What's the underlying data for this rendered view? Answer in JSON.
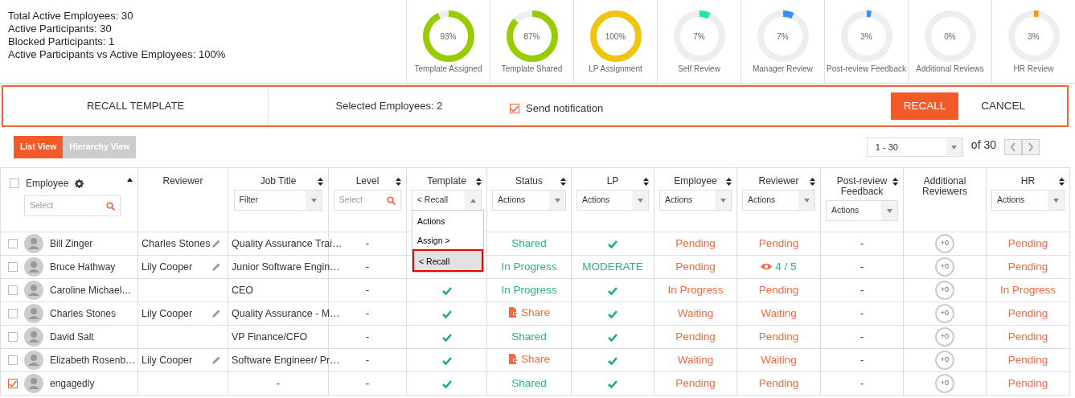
{
  "summary": [
    {
      "label": "Total Active Employees: ",
      "value": "30"
    },
    {
      "label": "Active Participants: ",
      "value": "30"
    },
    {
      "label": "Blocked Participants: ",
      "value": "1"
    },
    {
      "label": "Active Participants vs Active Employees: ",
      "value": "100%"
    }
  ],
  "progress": [
    {
      "label": "Template Assigned",
      "reading": "93%",
      "level": 0.93,
      "color": "#99cc00"
    },
    {
      "label": "Template Shared",
      "reading": "87%",
      "level": 0.87,
      "color": "#99cc00"
    },
    {
      "label": "LP Assignment",
      "reading": "100%",
      "level": 1,
      "color": "#f1c40f"
    },
    {
      "label": "Self Review",
      "reading": "7%",
      "level": 0.07,
      "color": "#1de9a0"
    },
    {
      "label": "Manager Review",
      "reading": "7%",
      "level": 0.07,
      "color": "#3a8ff0"
    },
    {
      "label": "Post-review Feedback",
      "reading": "3%",
      "level": 0.03,
      "color": "#3a8ff0"
    },
    {
      "label": "Additional Reviews",
      "reading": "0%",
      "level": 0
    },
    {
      "label": "HR Review",
      "reading": "3%",
      "level": 0.03,
      "color": "#ff9800"
    }
  ],
  "recall_bar": {
    "title": "RECALL TEMPLATE",
    "selected_text": "Selected Employees: 2",
    "notify": {
      "label": "Send notification",
      "checked": true
    },
    "buttons": [
      {
        "label": "RECALL",
        "kind": "primary"
      },
      {
        "label": "CANCEL",
        "kind": "plain"
      }
    ]
  },
  "views": [
    {
      "label": "List View",
      "selected": true
    },
    {
      "label": "Hierarchy View",
      "selected": false
    }
  ],
  "pagination": {
    "range": "1 - 30",
    "total": "of 30"
  },
  "table": {
    "all_checked": false,
    "columns": [
      {
        "label": "Employee",
        "sorted": true,
        "gear": true,
        "filter": {
          "kind": "search",
          "placeholder": "Select"
        }
      },
      {
        "label": "Reviewer"
      },
      {
        "label": "Job Title",
        "sortable": true,
        "filter": {
          "kind": "select",
          "value": "Filter"
        }
      },
      {
        "label": "Level",
        "sortable": true,
        "filter": {
          "kind": "search",
          "placeholder": "Select"
        }
      },
      {
        "label": "Template",
        "sortable": true,
        "filter": {
          "kind": "select",
          "value": "< Recall",
          "expanded": true,
          "options": [
            {
              "label": "Actions",
              "selected": false
            },
            {
              "label": "Assign >",
              "selected": false
            },
            {
              "label": "< Recall",
              "selected": true
            }
          ]
        }
      },
      {
        "label": "Status",
        "sortable": true,
        "filter": {
          "kind": "select",
          "value": "Actions"
        }
      },
      {
        "label": "LP",
        "sortable": true,
        "filter": {
          "kind": "select",
          "value": "Actions"
        }
      },
      {
        "label": "Employee",
        "sortable": true,
        "filter": {
          "kind": "select",
          "value": "Actions"
        }
      },
      {
        "label": "Reviewer",
        "sortable": true,
        "filter": {
          "kind": "select",
          "value": "Actions"
        }
      },
      {
        "label": "Post-review Feedback",
        "sortable": true,
        "filter": {
          "kind": "select",
          "value": "Actions"
        }
      },
      {
        "label": "Additional Reviewers"
      },
      {
        "label": "HR",
        "sortable": true,
        "filter": {
          "kind": "select",
          "value": "Actions"
        }
      }
    ],
    "rows": [
      {
        "checked": false,
        "cells": [
          {
            "kind": "person",
            "text": "Bill Zinger"
          },
          {
            "kind": "text",
            "text": "Charles Stones",
            "edit": true
          },
          {
            "kind": "text",
            "text": "Quality Assurance Trai…"
          },
          {
            "kind": "text",
            "text": "-"
          },
          null,
          {
            "kind": "text",
            "text": "Shared",
            "color": "#2bb673"
          },
          {
            "kind": "check"
          },
          {
            "kind": "text",
            "text": "Pending",
            "color": "#f26a3d"
          },
          {
            "kind": "text",
            "text": "Pending",
            "color": "#f26a3d"
          },
          {
            "kind": "text",
            "text": "-"
          },
          {
            "kind": "plus",
            "text": "+0"
          },
          {
            "kind": "text",
            "text": "Pending",
            "color": "#f26a3d"
          }
        ]
      },
      {
        "checked": false,
        "cells": [
          {
            "kind": "person",
            "text": "Bruce Hathway"
          },
          {
            "kind": "text",
            "text": "Lily Cooper",
            "edit": true
          },
          {
            "kind": "text",
            "text": "Junior Software Engin…"
          },
          {
            "kind": "text",
            "text": "-"
          },
          null,
          {
            "kind": "text",
            "text": "In Progress",
            "color": "#2bb673"
          },
          {
            "kind": "text",
            "text": "MODERATE",
            "color": "#2bb673"
          },
          {
            "kind": "text",
            "text": "Pending",
            "color": "#f26a3d"
          },
          {
            "kind": "views",
            "text": "4 / 5",
            "color": "#2bb673"
          },
          {
            "kind": "text",
            "text": "-"
          },
          {
            "kind": "plus",
            "text": "+0"
          },
          {
            "kind": "text",
            "text": "Pending",
            "color": "#f26a3d"
          }
        ]
      },
      {
        "checked": false,
        "cells": [
          {
            "kind": "person",
            "text": "Caroline Michael…"
          },
          null,
          {
            "kind": "text",
            "text": "CEO"
          },
          {
            "kind": "text",
            "text": "-"
          },
          {
            "kind": "check"
          },
          {
            "kind": "text",
            "text": "In Progress",
            "color": "#2bb673"
          },
          {
            "kind": "check"
          },
          {
            "kind": "text",
            "text": "In Progress",
            "color": "#f26a3d"
          },
          {
            "kind": "text",
            "text": "Pending",
            "color": "#f26a3d"
          },
          {
            "kind": "text",
            "text": "-"
          },
          {
            "kind": "plus",
            "text": "+0"
          },
          {
            "kind": "text",
            "text": "In Progress",
            "color": "#f26a3d"
          }
        ]
      },
      {
        "checked": false,
        "cells": [
          {
            "kind": "person",
            "text": "Charles Stones"
          },
          {
            "kind": "text",
            "text": "Lily Cooper",
            "edit": true
          },
          {
            "kind": "text",
            "text": "Quality Assurance - M…"
          },
          {
            "kind": "text",
            "text": "-"
          },
          {
            "kind": "check"
          },
          {
            "kind": "share",
            "text": "Share",
            "color": "#f26a3d"
          },
          {
            "kind": "check"
          },
          {
            "kind": "text",
            "text": "Waiting",
            "color": "#f26a3d"
          },
          {
            "kind": "text",
            "text": "Waiting",
            "color": "#f26a3d"
          },
          {
            "kind": "text",
            "text": "-"
          },
          {
            "kind": "plus",
            "text": "+0"
          },
          {
            "kind": "text",
            "text": "Pending",
            "color": "#f26a3d"
          }
        ]
      },
      {
        "checked": false,
        "cells": [
          {
            "kind": "person",
            "text": "David Salt"
          },
          null,
          {
            "kind": "text",
            "text": "VP Finance/CFO"
          },
          {
            "kind": "text",
            "text": "-"
          },
          {
            "kind": "check"
          },
          {
            "kind": "text",
            "text": "Shared",
            "color": "#2bb673"
          },
          {
            "kind": "check"
          },
          {
            "kind": "text",
            "text": "Pending",
            "color": "#f26a3d"
          },
          {
            "kind": "text",
            "text": "Pending",
            "color": "#f26a3d"
          },
          {
            "kind": "text",
            "text": "-"
          },
          {
            "kind": "plus",
            "text": "+0"
          },
          {
            "kind": "text",
            "text": "Pending",
            "color": "#f26a3d"
          }
        ]
      },
      {
        "checked": false,
        "cells": [
          {
            "kind": "person",
            "text": "Elizabeth Rosenb…"
          },
          {
            "kind": "text",
            "text": "Lily Cooper",
            "edit": true
          },
          {
            "kind": "text",
            "text": "Software Engineer/ Pr…"
          },
          {
            "kind": "text",
            "text": "-"
          },
          {
            "kind": "check"
          },
          {
            "kind": "share",
            "text": "Share",
            "color": "#f26a3d"
          },
          {
            "kind": "check"
          },
          {
            "kind": "text",
            "text": "Waiting",
            "color": "#f26a3d"
          },
          {
            "kind": "text",
            "text": "Waiting",
            "color": "#f26a3d"
          },
          {
            "kind": "text",
            "text": "-"
          },
          {
            "kind": "plus",
            "text": "+0"
          },
          {
            "kind": "text",
            "text": "Pending",
            "color": "#f26a3d"
          }
        ]
      },
      {
        "checked": true,
        "cells": [
          {
            "kind": "person",
            "text": "engagedly"
          },
          null,
          {
            "kind": "dash",
            "text": "-"
          },
          {
            "kind": "text",
            "text": "-"
          },
          {
            "kind": "check"
          },
          {
            "kind": "text",
            "text": "Shared",
            "color": "#2bb673"
          },
          {
            "kind": "check"
          },
          {
            "kind": "text",
            "text": "Pending",
            "color": "#f26a3d"
          },
          {
            "kind": "text",
            "text": "Pending",
            "color": "#f26a3d"
          },
          {
            "kind": "text",
            "text": "-"
          },
          {
            "kind": "plus",
            "text": "+0"
          },
          {
            "kind": "text",
            "text": "Pending",
            "color": "#f26a3d"
          }
        ]
      }
    ]
  }
}
